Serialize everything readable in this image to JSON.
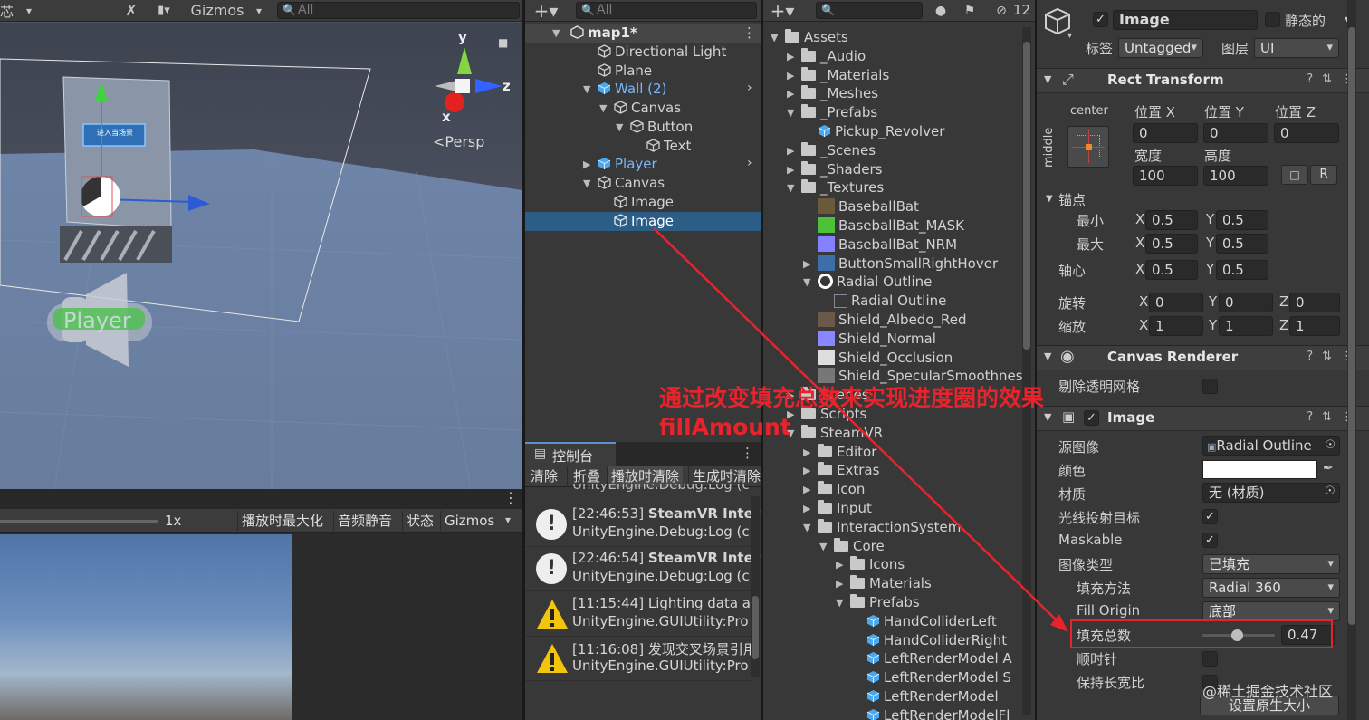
{
  "scene": {
    "frag_left": "芯",
    "gizmos_label": "Gizmos",
    "search_placeholder": "All",
    "persp_label": "<Persp",
    "axis_y": "y",
    "axis_x": "x",
    "axis_z": "z",
    "button_text": "进入当场景",
    "player_label": "Player"
  },
  "game": {
    "scale_label": "1x",
    "maximize_label": "播放时最大化",
    "mute_label": "音频静音",
    "stats_label": "状态",
    "gizmos_label": "Gizmos"
  },
  "hierarchy": {
    "search_placeholder": "All",
    "items": [
      {
        "label": "map1*"
      },
      {
        "label": "Directional Light"
      },
      {
        "label": "Plane"
      },
      {
        "label": "Wall (2)"
      },
      {
        "label": "Canvas"
      },
      {
        "label": "Button"
      },
      {
        "label": "Text"
      },
      {
        "label": "Player"
      },
      {
        "label": "Canvas"
      },
      {
        "label": "Image"
      },
      {
        "label": "Image"
      }
    ]
  },
  "console": {
    "title": "控制台",
    "buttons": [
      "清除",
      "折叠",
      "播放时清除",
      "生成时清除"
    ],
    "top_partial": "UnityEngine.Debug:Log (c",
    "entries": [
      {
        "time": "[22:46:53]",
        "bold": "SteamVR Inter",
        "line2": "UnityEngine.Debug:Log (c",
        "kind": "info"
      },
      {
        "time": "[22:46:54]",
        "bold": "SteamVR Inter",
        "line2": "UnityEngine.Debug:Log (c",
        "kind": "info"
      },
      {
        "time": "[11:15:44]",
        "bold": "Lighting data as",
        "line2": "UnityEngine.GUIUtility:Pro",
        "kind": "warning"
      },
      {
        "time": "[11:16:08]",
        "bold": "发现交叉场景引用",
        "line2": "UnityEngine.GUIUtility:Pro",
        "kind": "warning"
      }
    ]
  },
  "project": {
    "hidden_count": "12",
    "items": [
      {
        "label": "Assets"
      },
      {
        "label": "_Audio"
      },
      {
        "label": "_Materials"
      },
      {
        "label": "_Meshes"
      },
      {
        "label": "_Prefabs"
      },
      {
        "label": "Pickup_Revolver"
      },
      {
        "label": "_Scenes"
      },
      {
        "label": "_Shaders"
      },
      {
        "label": "_Textures"
      },
      {
        "label": "BaseballBat"
      },
      {
        "label": "BaseballBat_MASK"
      },
      {
        "label": "BaseballBat_NRM"
      },
      {
        "label": "ButtonSmallRightHover"
      },
      {
        "label": "Radial Outline"
      },
      {
        "label": "Radial Outline"
      },
      {
        "label": "Shield_Albedo_Red"
      },
      {
        "label": "Shield_Normal"
      },
      {
        "label": "Shield_Occlusion"
      },
      {
        "label": "Shield_SpecularSmoothnes"
      },
      {
        "label": "Scenes"
      },
      {
        "label": "Scripts"
      },
      {
        "label": "SteamVR"
      },
      {
        "label": "Editor"
      },
      {
        "label": "Extras"
      },
      {
        "label": "Icon"
      },
      {
        "label": "Input"
      },
      {
        "label": "InteractionSystem"
      },
      {
        "label": "Core"
      },
      {
        "label": "Icons"
      },
      {
        "label": "Materials"
      },
      {
        "label": "Prefabs"
      },
      {
        "label": "HandColliderLeft"
      },
      {
        "label": "HandColliderRight"
      },
      {
        "label": "LeftRenderModel A"
      },
      {
        "label": "LeftRenderModel S"
      },
      {
        "label": "LeftRenderModel"
      },
      {
        "label": "LeftRenderModelFl"
      }
    ]
  },
  "inspector": {
    "object_name": "Image",
    "static_label": "静态的",
    "tag_label": "标签",
    "tag_value": "Untagged",
    "layer_label": "图层",
    "layer_value": "UI",
    "rect_transform": {
      "title": "Rect Transform",
      "anchor_h": "center",
      "anchor_v": "middle",
      "pos_x_label": "位置 X",
      "pos_y_label": "位置 Y",
      "pos_z_label": "位置 Z",
      "pos_x": "0",
      "pos_y": "0",
      "pos_z": "0",
      "width_label": "宽度",
      "height_label": "高度",
      "width": "100",
      "height": "100",
      "r_label": "R",
      "anchors_label": "锚点",
      "min_label": "最小",
      "max_label": "最大",
      "pivot_label": "轴心",
      "x": "X",
      "y": "Y",
      "z": "Z",
      "min_x": "0.5",
      "min_y": "0.5",
      "max_x": "0.5",
      "max_y": "0.5",
      "pivot_x": "0.5",
      "pivot_y": "0.5",
      "rotation_label": "旋转",
      "rot_x": "0",
      "rot_y": "0",
      "rot_z": "0",
      "scale_label": "缩放",
      "scale_x": "1",
      "scale_y": "1",
      "scale_z": "1"
    },
    "canvas_renderer": {
      "title": "Canvas Renderer",
      "cull_label": "剔除透明网格"
    },
    "image": {
      "title": "Image",
      "source_label": "源图像",
      "source_value": "Radial Outline",
      "color_label": "颜色",
      "color_value": "#ffffff",
      "material_label": "材质",
      "material_value": "无 (材质)",
      "raycast_label": "光线投射目标",
      "maskable_label": "Maskable",
      "image_type_label": "图像类型",
      "image_type_value": "已填充",
      "fill_method_label": "填充方法",
      "fill_method_value": "Radial 360",
      "fill_origin_label": "Fill Origin",
      "fill_origin_value": "底部",
      "fill_amount_label": "填充总数",
      "fill_amount_value": "0.47",
      "fill_amount_fraction": 0.47,
      "clockwise_label": "顺时针",
      "preserve_label": "保持长宽比",
      "native_size_label": "设置原生大小"
    }
  },
  "annotation": {
    "line1": "通过改变填充总数来实现进度圈的效果",
    "line2": "fillAmount",
    "color": "#e8232b"
  },
  "watermark": "@稀土掘金技术社区"
}
